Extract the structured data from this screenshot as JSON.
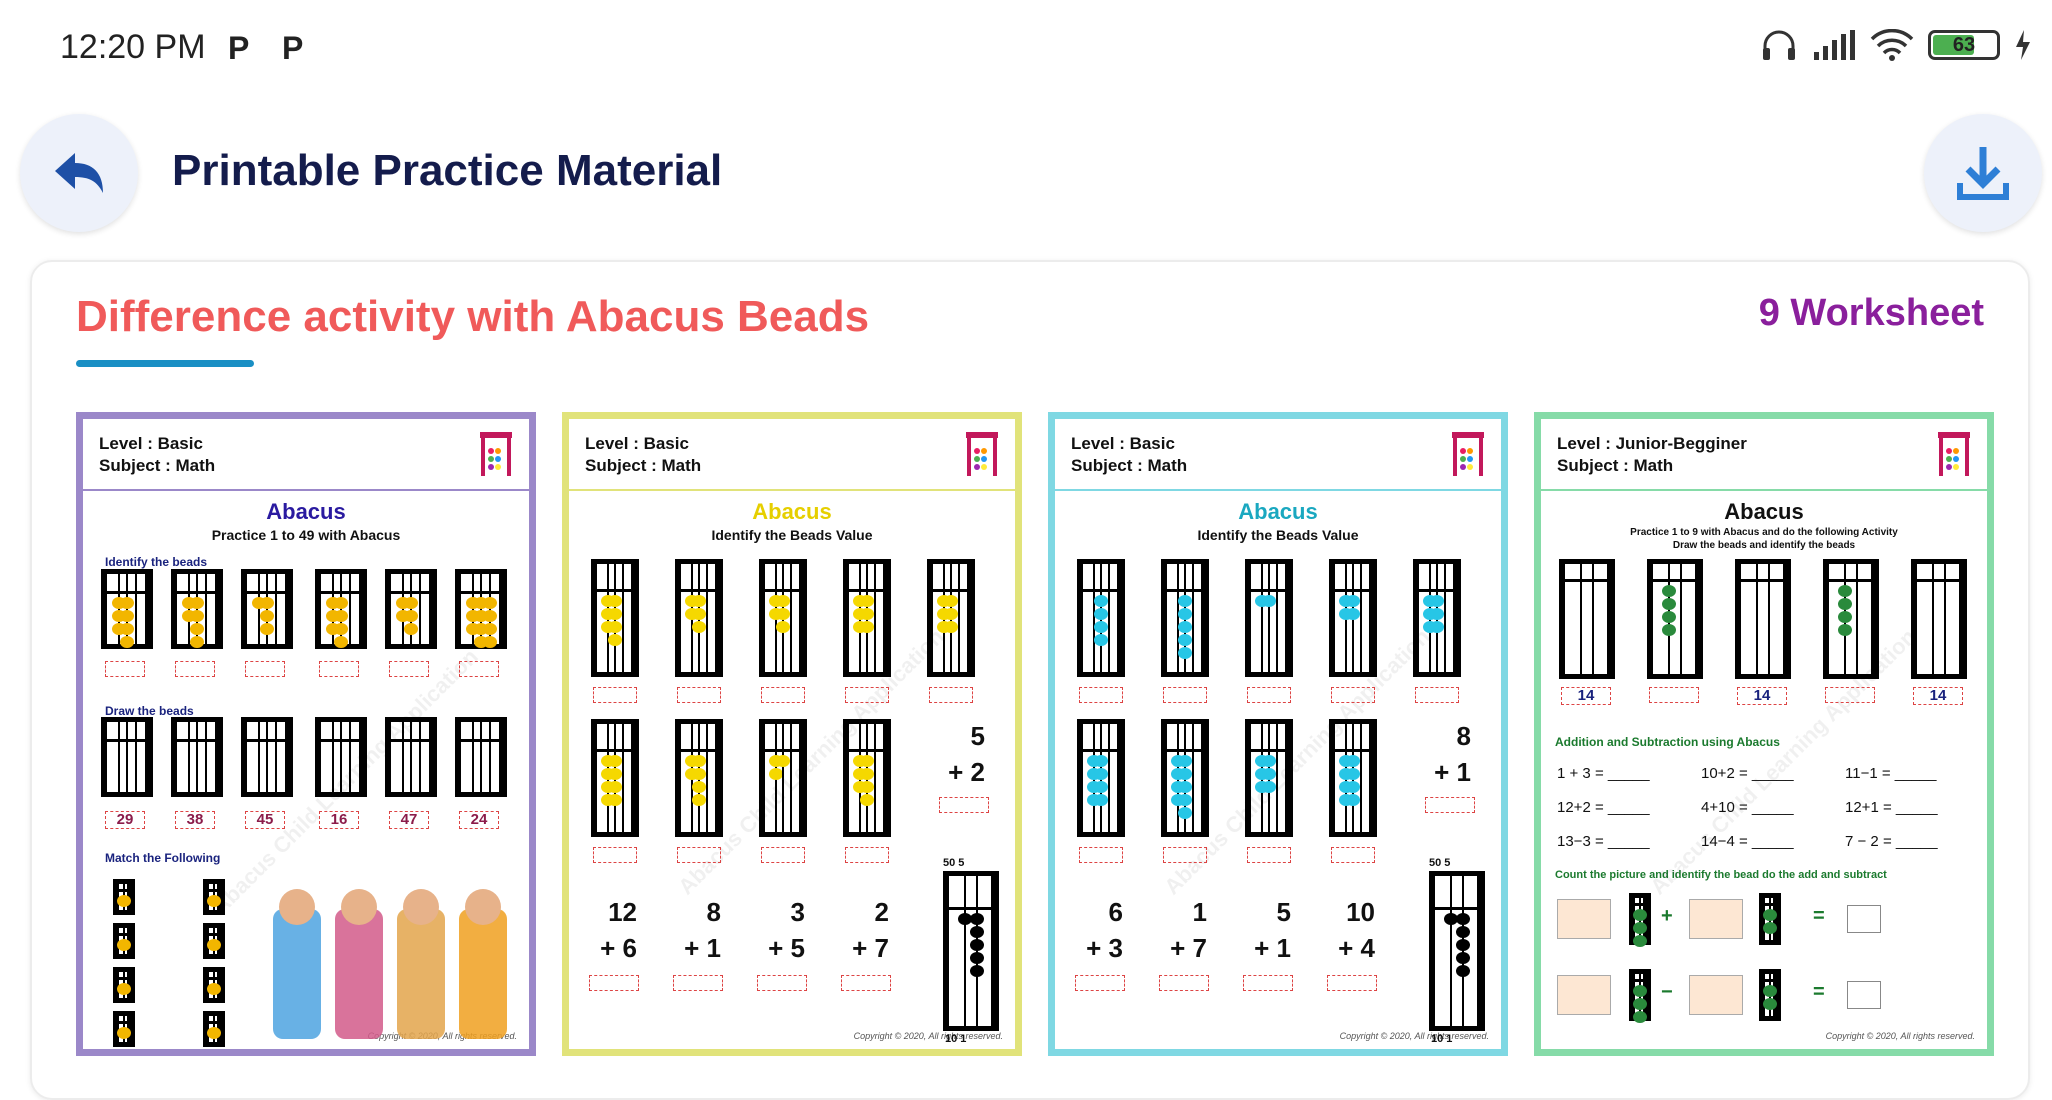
{
  "status": {
    "time": "12:20 PM",
    "p1": "P",
    "p2": "P",
    "battery": "63"
  },
  "header": {
    "title": "Printable Practice Material"
  },
  "section": {
    "title": "Difference activity with Abacus Beads",
    "count": "9 Worksheet"
  },
  "colors": {
    "accent_red": "#f05a5a",
    "underline": "#1a8fc4",
    "count_purple": "#8a1f9c",
    "title_navy": "#141c4c"
  },
  "worksheets": [
    {
      "border": "#9b88c9",
      "level": "Level : Basic",
      "subject": "Subject : Math",
      "title": "Abacus",
      "title_color": "#2a1aa0",
      "subtitle": "Practice 1 to 49 with Abacus",
      "sections": [
        "Identify the beads",
        "Draw the beads",
        "Match the Following"
      ],
      "draw_numbers": [
        "29",
        "38",
        "45",
        "16",
        "47",
        "24"
      ],
      "copyright": "Copyright © 2020, All rights reserved."
    },
    {
      "border": "#e1e37a",
      "level": "Level : Basic",
      "subject": "Subject : Math",
      "title": "Abacus",
      "title_color": "#e6cf00",
      "subtitle": "Identify the Beads Value",
      "side_sum": [
        "5",
        "+ 2"
      ],
      "sums": [
        [
          "12",
          "+ 6"
        ],
        [
          "8",
          "+ 1"
        ],
        [
          "3",
          "+ 5"
        ],
        [
          "2",
          "+ 7"
        ]
      ],
      "abacus_labels": {
        "top": [
          "50",
          "5"
        ],
        "bottom": [
          "10",
          "1"
        ]
      },
      "copyright": "Copyright © 2020, All rights reserved."
    },
    {
      "border": "#7fd8e3",
      "level": "Level : Basic",
      "subject": "Subject : Math",
      "title": "Abacus",
      "title_color": "#1aa8c0",
      "subtitle": "Identify the Beads Value",
      "side_sum": [
        "8",
        "+ 1"
      ],
      "sums": [
        [
          "6",
          "+ 3"
        ],
        [
          "1",
          "+ 7"
        ],
        [
          "5",
          "+ 1"
        ],
        [
          "10",
          "+ 4"
        ]
      ],
      "abacus_labels": {
        "top": [
          "50",
          "5"
        ],
        "bottom": [
          "10",
          "1"
        ]
      },
      "copyright": "Copyright © 2020, All rights reserved."
    },
    {
      "border": "#86dba8",
      "level": "Level : Junior-Begginer",
      "subject": "Subject : Math",
      "title": "Abacus",
      "title_color": "#111111",
      "subtitle": "Practice 1 to 9 with Abacus and do the following Activity",
      "subtitle2": "Draw the beads and identify the beads",
      "row_numbers": [
        "14",
        "14",
        "14"
      ],
      "section_add": "Addition and Subtraction using Abacus",
      "equations": [
        "1 + 3 = _____",
        "10+2 = _____",
        "11−1 = _____",
        "12+2 = _____",
        "4+10 = _____",
        "12+1 = _____",
        "13−3 = _____",
        "14−4 = _____",
        "7 − 2 = _____"
      ],
      "section_count": "Count the picture and identify the bead do the add and subtract",
      "ops": [
        "+",
        "=",
        "−",
        "="
      ],
      "copyright": "Copyright © 2020, All rights reserved."
    }
  ]
}
